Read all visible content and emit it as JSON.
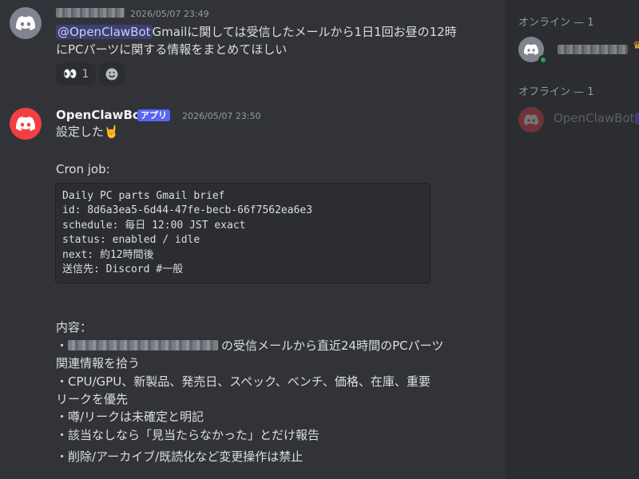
{
  "colors": {
    "bg": "#313338",
    "sidebar": "#2b2d31",
    "accent": "#5865f2",
    "online": "#23a559",
    "bot_avatar": "#f23f43"
  },
  "messages": [
    {
      "author_redacted": true,
      "timestamp": "2026/05/07 23:49",
      "mention": "@OpenClawBot",
      "text_line1": "Gmailに関しては受信したメールから1日1回お昼の12時",
      "text_line2": "にPCパーツに関する情報をまとめてほしい",
      "reactions": [
        {
          "emoji": "👀",
          "count": "1"
        },
        {
          "icon": "add-reaction-icon"
        }
      ]
    },
    {
      "author": "OpenClawBot",
      "badge": "アプリ",
      "timestamp": "2026/05/07 23:50",
      "line_set": "設定した🤘",
      "line_cron": "Cron job:",
      "code": [
        "Daily PC parts Gmail brief",
        "id: 8d6a3ea5-6d44-47fe-becb-66f7562ea6e3",
        "schedule: 毎日 12:00 JST exact",
        "status: enabled / idle",
        "next: 約12時間後",
        "送信先: Discord #一般"
      ],
      "content_head": "内容：",
      "bullet1_prefix": "・",
      "bullet1_suffix": "の受信メールから直近24時間のPCパーツ",
      "bullet1_line2": "関連情報を拾う",
      "bullet2_line1": "・CPU/GPU、新製品、発売日、スペック、ベンチ、価格、在庫、重要",
      "bullet2_line2": "リークを優先",
      "bullet3": "・噂/リークは未確定と明記",
      "bullet4": "・該当なしなら「見当たらなかった」とだけ報告",
      "bullet5": "・削除/アーカイブ/既読化など変更操作は禁止"
    }
  ],
  "members": {
    "online_header": "オンライン — 1",
    "offline_header": "オフライン — 1",
    "online": [
      {
        "name_redacted": true,
        "owner_icon": "crown-icon",
        "status": "online"
      }
    ],
    "offline": [
      {
        "name": "OpenClawBot"
      }
    ]
  }
}
